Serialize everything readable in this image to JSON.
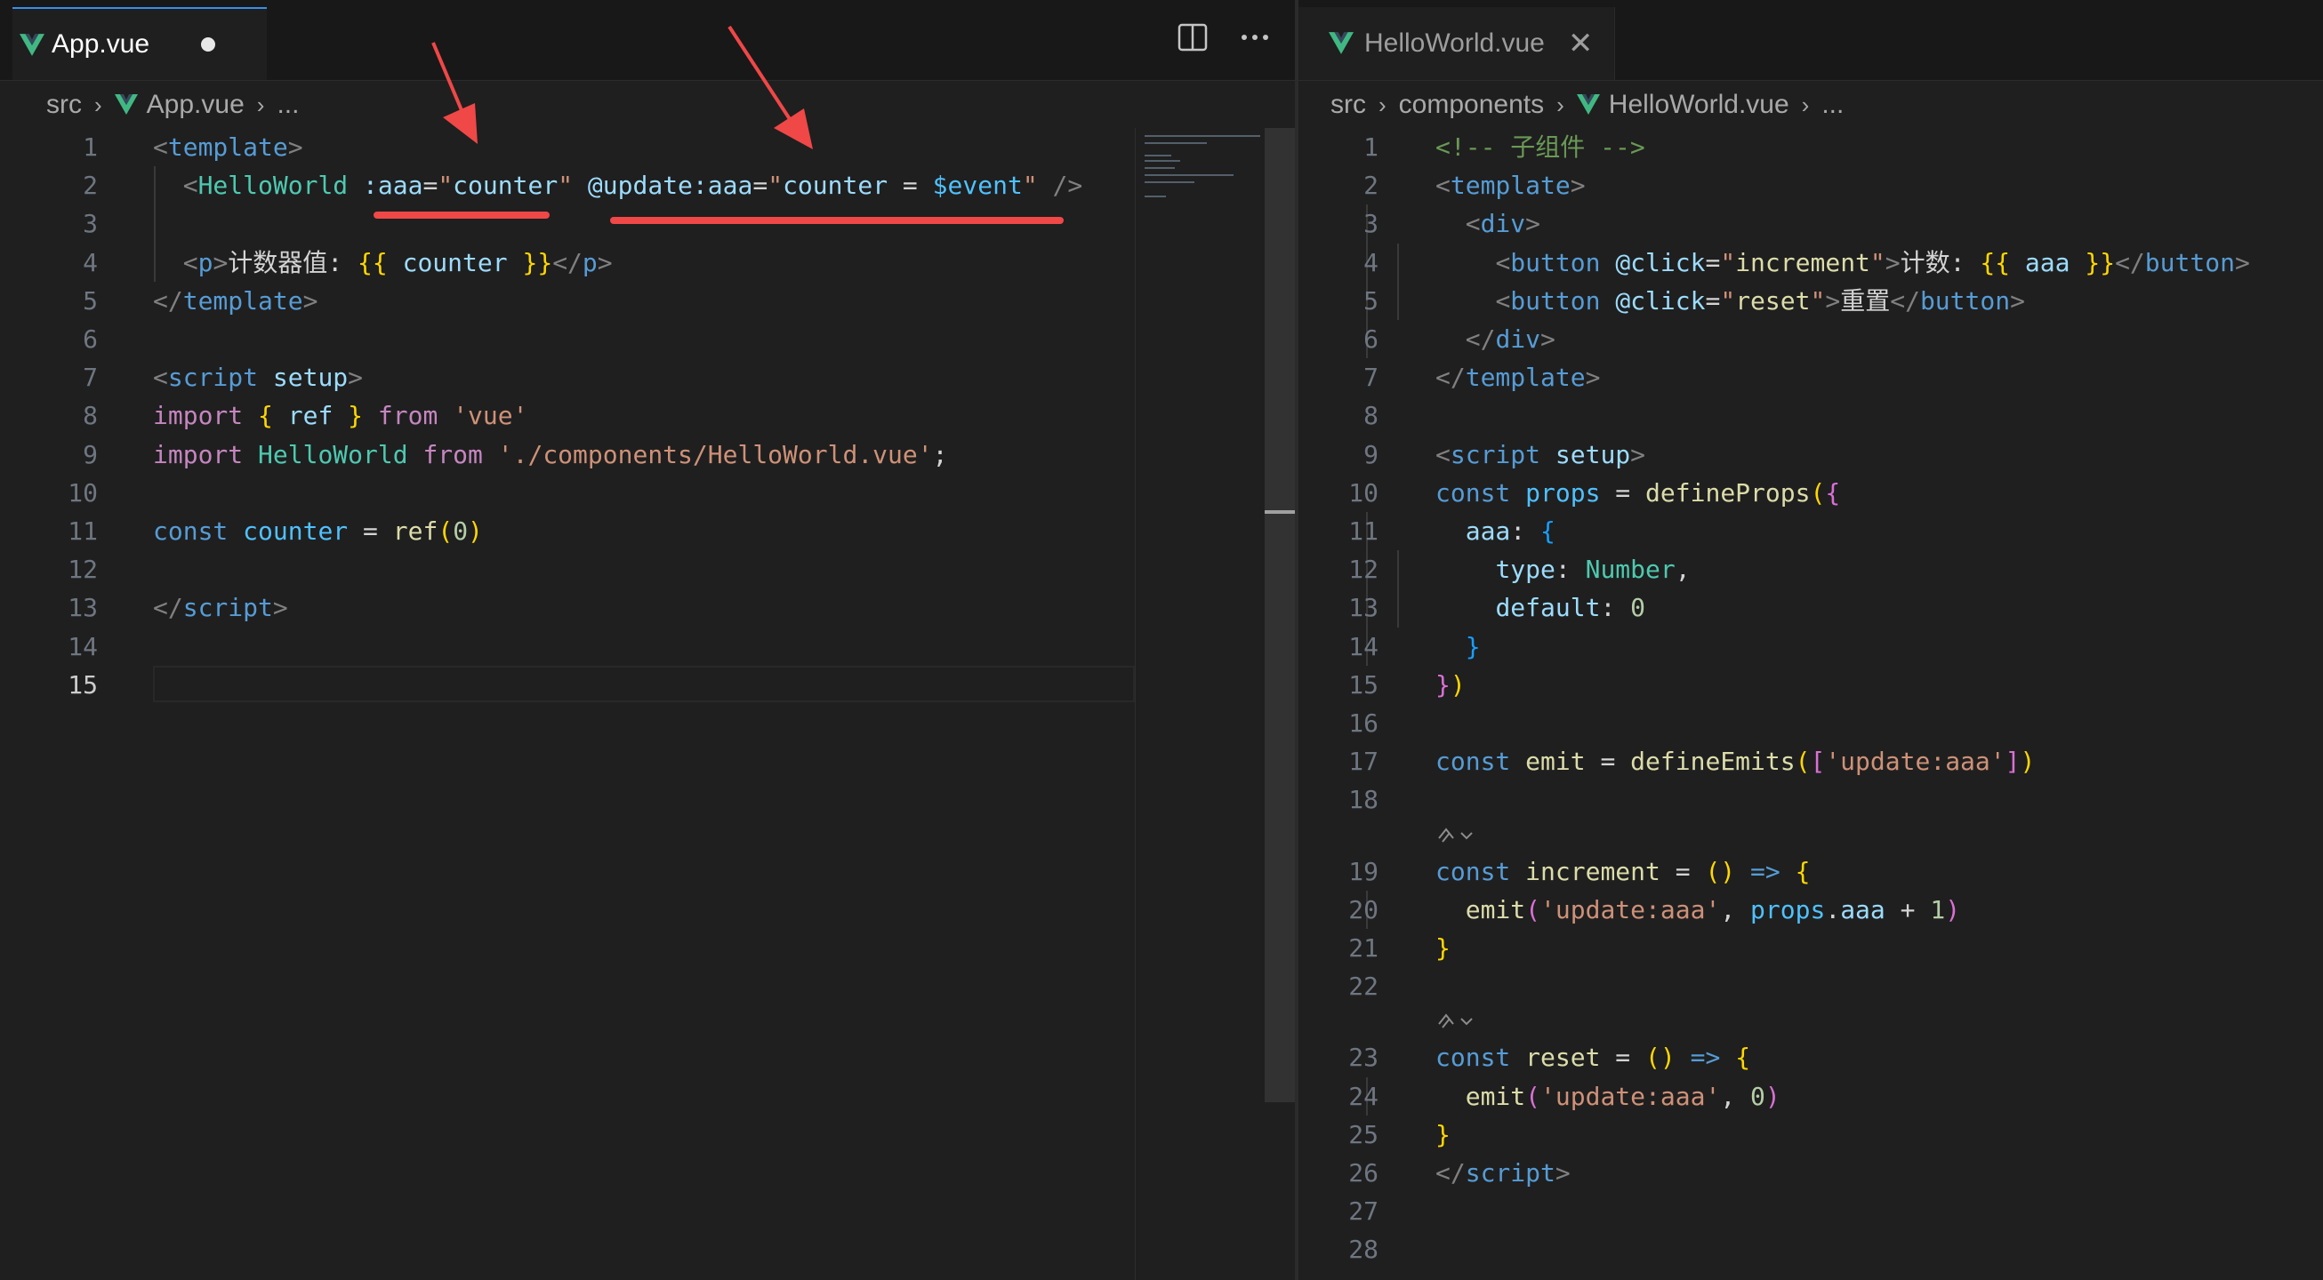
{
  "left_pane": {
    "tab": {
      "label": "App.vue",
      "modified": true
    },
    "breadcrumb": {
      "folder": "src",
      "file": "App.vue",
      "more": "..."
    },
    "current_line": 15,
    "lines": [
      {
        "n": "1",
        "tokens": [
          [
            "t-punc",
            "<"
          ],
          [
            "t-tag",
            "template"
          ],
          [
            "t-punc",
            ">"
          ]
        ]
      },
      {
        "n": "2",
        "tokens": [
          [
            "t-text",
            "  "
          ],
          [
            "t-punc",
            "<"
          ],
          [
            "t-comp",
            "HelloWorld"
          ],
          [
            "t-text",
            " "
          ],
          [
            "t-attr",
            ":aaa"
          ],
          [
            "t-text",
            "="
          ],
          [
            "t-str",
            "\""
          ],
          [
            "t-attr",
            "counter"
          ],
          [
            "t-str",
            "\""
          ],
          [
            "t-text",
            " "
          ],
          [
            "t-attr",
            "@update:aaa"
          ],
          [
            "t-text",
            "="
          ],
          [
            "t-str",
            "\""
          ],
          [
            "t-attr",
            "counter"
          ],
          [
            "t-text",
            " = "
          ],
          [
            "t-var",
            "$event"
          ],
          [
            "t-str",
            "\""
          ],
          [
            "t-text",
            " "
          ],
          [
            "t-punc",
            "/>"
          ]
        ]
      },
      {
        "n": "3",
        "tokens": []
      },
      {
        "n": "4",
        "tokens": [
          [
            "t-text",
            "  "
          ],
          [
            "t-punc",
            "<"
          ],
          [
            "t-tag",
            "p"
          ],
          [
            "t-punc",
            ">"
          ],
          [
            "t-text",
            "计数器值: "
          ],
          [
            "t-brace",
            "{{"
          ],
          [
            "t-text",
            " "
          ],
          [
            "t-attr",
            "counter"
          ],
          [
            "t-text",
            " "
          ],
          [
            "t-brace",
            "}}"
          ],
          [
            "t-punc",
            "</"
          ],
          [
            "t-tag",
            "p"
          ],
          [
            "t-punc",
            ">"
          ]
        ]
      },
      {
        "n": "5",
        "tokens": [
          [
            "t-punc",
            "</"
          ],
          [
            "t-tag",
            "template"
          ],
          [
            "t-punc",
            ">"
          ]
        ]
      },
      {
        "n": "6",
        "tokens": []
      },
      {
        "n": "7",
        "tokens": [
          [
            "t-punc",
            "<"
          ],
          [
            "t-tag",
            "script"
          ],
          [
            "t-text",
            " "
          ],
          [
            "t-attr",
            "setup"
          ],
          [
            "t-punc",
            ">"
          ]
        ]
      },
      {
        "n": "8",
        "tokens": [
          [
            "t-kw",
            "import"
          ],
          [
            "t-text",
            " "
          ],
          [
            "t-brace",
            "{"
          ],
          [
            "t-text",
            " "
          ],
          [
            "t-attr",
            "ref"
          ],
          [
            "t-text",
            " "
          ],
          [
            "t-brace",
            "}"
          ],
          [
            "t-text",
            " "
          ],
          [
            "t-kw",
            "from"
          ],
          [
            "t-text",
            " "
          ],
          [
            "t-str",
            "'vue'"
          ]
        ]
      },
      {
        "n": "9",
        "tokens": [
          [
            "t-kw",
            "import"
          ],
          [
            "t-text",
            " "
          ],
          [
            "t-comp",
            "HelloWorld"
          ],
          [
            "t-text",
            " "
          ],
          [
            "t-kw",
            "from"
          ],
          [
            "t-text",
            " "
          ],
          [
            "t-str",
            "'./components/HelloWorld.vue'"
          ],
          [
            "t-text",
            ";"
          ]
        ]
      },
      {
        "n": "10",
        "tokens": []
      },
      {
        "n": "11",
        "tokens": [
          [
            "t-const",
            "const"
          ],
          [
            "t-text",
            " "
          ],
          [
            "t-var",
            "counter"
          ],
          [
            "t-text",
            " = "
          ],
          [
            "t-fn",
            "ref"
          ],
          [
            "t-brace",
            "("
          ],
          [
            "t-num",
            "0"
          ],
          [
            "t-brace",
            ")"
          ]
        ]
      },
      {
        "n": "12",
        "tokens": []
      },
      {
        "n": "13",
        "tokens": [
          [
            "t-punc",
            "</"
          ],
          [
            "t-tag",
            "script"
          ],
          [
            "t-punc",
            ">"
          ]
        ]
      },
      {
        "n": "14",
        "tokens": []
      },
      {
        "n": "15",
        "tokens": []
      }
    ]
  },
  "right_pane": {
    "tab": {
      "label": "HelloWorld.vue",
      "close_glyph": "✕"
    },
    "breadcrumb": {
      "folder": "src",
      "subfolder": "components",
      "file": "HelloWorld.vue",
      "more": "..."
    },
    "lines": [
      {
        "n": "1",
        "tokens": [
          [
            "t-comment",
            "<!-- 子组件 -->"
          ]
        ]
      },
      {
        "n": "2",
        "tokens": [
          [
            "t-punc",
            "<"
          ],
          [
            "t-tag",
            "template"
          ],
          [
            "t-punc",
            ">"
          ]
        ]
      },
      {
        "n": "3",
        "tokens": [
          [
            "t-text",
            "  "
          ],
          [
            "t-punc",
            "<"
          ],
          [
            "t-tag",
            "div"
          ],
          [
            "t-punc",
            ">"
          ]
        ]
      },
      {
        "n": "4",
        "tokens": [
          [
            "t-text",
            "    "
          ],
          [
            "t-punc",
            "<"
          ],
          [
            "t-tag",
            "button"
          ],
          [
            "t-text",
            " "
          ],
          [
            "t-attr",
            "@click"
          ],
          [
            "t-text",
            "="
          ],
          [
            "t-str",
            "\""
          ],
          [
            "t-fn",
            "increment"
          ],
          [
            "t-str",
            "\""
          ],
          [
            "t-punc",
            ">"
          ],
          [
            "t-text",
            "计数: "
          ],
          [
            "t-brace",
            "{{"
          ],
          [
            "t-text",
            " "
          ],
          [
            "t-attr",
            "aaa"
          ],
          [
            "t-text",
            " "
          ],
          [
            "t-brace",
            "}}"
          ],
          [
            "t-punc",
            "</"
          ],
          [
            "t-tag",
            "button"
          ],
          [
            "t-punc",
            ">"
          ]
        ]
      },
      {
        "n": "5",
        "tokens": [
          [
            "t-text",
            "    "
          ],
          [
            "t-punc",
            "<"
          ],
          [
            "t-tag",
            "button"
          ],
          [
            "t-text",
            " "
          ],
          [
            "t-attr",
            "@click"
          ],
          [
            "t-text",
            "="
          ],
          [
            "t-str",
            "\""
          ],
          [
            "t-fn",
            "reset"
          ],
          [
            "t-str",
            "\""
          ],
          [
            "t-punc",
            ">"
          ],
          [
            "t-text",
            "重置"
          ],
          [
            "t-punc",
            "</"
          ],
          [
            "t-tag",
            "button"
          ],
          [
            "t-punc",
            ">"
          ]
        ]
      },
      {
        "n": "6",
        "tokens": [
          [
            "t-text",
            "  "
          ],
          [
            "t-punc",
            "</"
          ],
          [
            "t-tag",
            "div"
          ],
          [
            "t-punc",
            ">"
          ]
        ]
      },
      {
        "n": "7",
        "tokens": [
          [
            "t-punc",
            "</"
          ],
          [
            "t-tag",
            "template"
          ],
          [
            "t-punc",
            ">"
          ]
        ]
      },
      {
        "n": "8",
        "tokens": []
      },
      {
        "n": "9",
        "tokens": [
          [
            "t-punc",
            "<"
          ],
          [
            "t-tag",
            "script"
          ],
          [
            "t-text",
            " "
          ],
          [
            "t-attr",
            "setup"
          ],
          [
            "t-punc",
            ">"
          ]
        ]
      },
      {
        "n": "10",
        "tokens": [
          [
            "t-const",
            "const"
          ],
          [
            "t-text",
            " "
          ],
          [
            "t-var",
            "props"
          ],
          [
            "t-text",
            " = "
          ],
          [
            "t-fn",
            "defineProps"
          ],
          [
            "t-brace",
            "("
          ],
          [
            "t-brace2",
            "{"
          ]
        ]
      },
      {
        "n": "11",
        "tokens": [
          [
            "t-text",
            "  "
          ],
          [
            "t-prop",
            "aaa"
          ],
          [
            "t-text",
            ": "
          ],
          [
            "t-brace3",
            "{"
          ]
        ]
      },
      {
        "n": "12",
        "tokens": [
          [
            "t-text",
            "    "
          ],
          [
            "t-prop",
            "type"
          ],
          [
            "t-text",
            ": "
          ],
          [
            "t-type",
            "Number"
          ],
          [
            "t-text",
            ","
          ]
        ]
      },
      {
        "n": "13",
        "tokens": [
          [
            "t-text",
            "    "
          ],
          [
            "t-prop",
            "default"
          ],
          [
            "t-text",
            ": "
          ],
          [
            "t-num",
            "0"
          ]
        ]
      },
      {
        "n": "14",
        "tokens": [
          [
            "t-text",
            "  "
          ],
          [
            "t-brace3",
            "}"
          ]
        ]
      },
      {
        "n": "15",
        "tokens": [
          [
            "t-brace2",
            "}"
          ],
          [
            "t-brace",
            ")"
          ]
        ]
      },
      {
        "n": "16",
        "tokens": []
      },
      {
        "n": "17",
        "tokens": [
          [
            "t-const",
            "const"
          ],
          [
            "t-text",
            " "
          ],
          [
            "t-fn",
            "emit"
          ],
          [
            "t-text",
            " = "
          ],
          [
            "t-fn",
            "defineEmits"
          ],
          [
            "t-brace",
            "("
          ],
          [
            "t-brace2",
            "["
          ],
          [
            "t-str",
            "'update:aaa'"
          ],
          [
            "t-brace2",
            "]"
          ],
          [
            "t-brace",
            ")"
          ]
        ]
      },
      {
        "n": "18",
        "tokens": []
      },
      {
        "n": "19",
        "tokens": [
          [
            "t-const",
            "const"
          ],
          [
            "t-text",
            " "
          ],
          [
            "t-fn",
            "increment"
          ],
          [
            "t-text",
            " = "
          ],
          [
            "t-brace",
            "()"
          ],
          [
            "t-text",
            " "
          ],
          [
            "t-const",
            "=>"
          ],
          [
            "t-text",
            " "
          ],
          [
            "t-brace",
            "{"
          ]
        ]
      },
      {
        "n": "20",
        "tokens": [
          [
            "t-text",
            "  "
          ],
          [
            "t-fn",
            "emit"
          ],
          [
            "t-brace2",
            "("
          ],
          [
            "t-str",
            "'update:aaa'"
          ],
          [
            "t-text",
            ", "
          ],
          [
            "t-var",
            "props"
          ],
          [
            "t-text",
            "."
          ],
          [
            "t-prop",
            "aaa"
          ],
          [
            "t-text",
            " + "
          ],
          [
            "t-num",
            "1"
          ],
          [
            "t-brace2",
            ")"
          ]
        ]
      },
      {
        "n": "21",
        "tokens": [
          [
            "t-brace",
            "}"
          ]
        ]
      },
      {
        "n": "22",
        "tokens": []
      },
      {
        "n": "23",
        "tokens": [
          [
            "t-const",
            "const"
          ],
          [
            "t-text",
            " "
          ],
          [
            "t-fn",
            "reset"
          ],
          [
            "t-text",
            " = "
          ],
          [
            "t-brace",
            "()"
          ],
          [
            "t-text",
            " "
          ],
          [
            "t-const",
            "=>"
          ],
          [
            "t-text",
            " "
          ],
          [
            "t-brace",
            "{"
          ]
        ]
      },
      {
        "n": "24",
        "tokens": [
          [
            "t-text",
            "  "
          ],
          [
            "t-fn",
            "emit"
          ],
          [
            "t-brace2",
            "("
          ],
          [
            "t-str",
            "'update:aaa'"
          ],
          [
            "t-text",
            ", "
          ],
          [
            "t-num",
            "0"
          ],
          [
            "t-brace2",
            ")"
          ]
        ]
      },
      {
        "n": "25",
        "tokens": [
          [
            "t-brace",
            "}"
          ]
        ]
      },
      {
        "n": "26",
        "tokens": [
          [
            "t-punc",
            "</"
          ],
          [
            "t-tag",
            "script"
          ],
          [
            "t-punc",
            ">"
          ]
        ]
      },
      {
        "n": "27",
        "tokens": []
      },
      {
        "n": "28",
        "tokens": []
      }
    ]
  },
  "colors": {
    "accent": "#3b8eea",
    "annotation": "#f04747",
    "vue_green": "#41b883"
  }
}
